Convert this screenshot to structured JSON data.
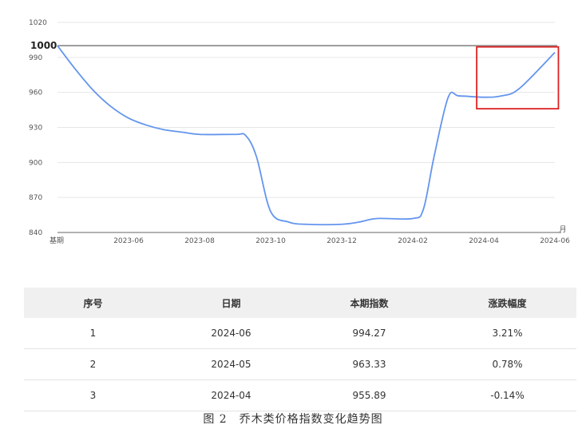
{
  "chart_data": {
    "type": "line",
    "x": [
      "基期",
      "2023-06",
      "2023-08",
      "2023-10",
      "2023-12",
      "2024-02",
      "2024-04",
      "2024-06"
    ],
    "series": [
      {
        "values": [
          [
            0,
            1000
          ],
          [
            0.5,
            980
          ],
          [
            1.0,
            962
          ],
          [
            1.5,
            948
          ],
          [
            2.0,
            938
          ],
          [
            2.5,
            932
          ],
          [
            3.0,
            928
          ],
          [
            3.5,
            926
          ],
          [
            4.0,
            924
          ],
          [
            5.0,
            924
          ],
          [
            5.3,
            923
          ],
          [
            5.6,
            905
          ],
          [
            6.0,
            858
          ],
          [
            6.5,
            849
          ],
          [
            7.0,
            847
          ],
          [
            8.0,
            847
          ],
          [
            8.5,
            849
          ],
          [
            9.0,
            852
          ],
          [
            10.0,
            852
          ],
          [
            10.3,
            860
          ],
          [
            10.6,
            905
          ],
          [
            11.0,
            956
          ],
          [
            11.3,
            957
          ],
          [
            12.0,
            955.89
          ],
          [
            12.5,
            957
          ],
          [
            13.0,
            963.33
          ],
          [
            14.0,
            994.27
          ]
        ]
      }
    ],
    "x_unit": "月",
    "y_ticks": [
      840,
      870,
      900,
      930,
      960,
      990,
      1020
    ],
    "ylim": [
      840,
      1020
    ],
    "xlim": [
      0,
      14
    ],
    "reference_line": {
      "value": 1000,
      "label": "1000"
    },
    "highlight_box": {
      "x_range": [
        11.8,
        14.1
      ],
      "y_range": [
        946,
        999
      ]
    },
    "grid": true,
    "colors": {
      "line": "#6495ED",
      "reference": "#888888",
      "highlight": "#dd2222"
    }
  },
  "table": {
    "headers": [
      "序号",
      "日期",
      "本期指数",
      "涨跌幅度"
    ],
    "rows": [
      [
        "1",
        "2024-06",
        "994.27",
        "3.21%"
      ],
      [
        "2",
        "2024-05",
        "963.33",
        "0.78%"
      ],
      [
        "3",
        "2024-04",
        "955.89",
        "-0.14%"
      ]
    ]
  },
  "caption": "图 2　乔木类价格指数变化趋势图"
}
